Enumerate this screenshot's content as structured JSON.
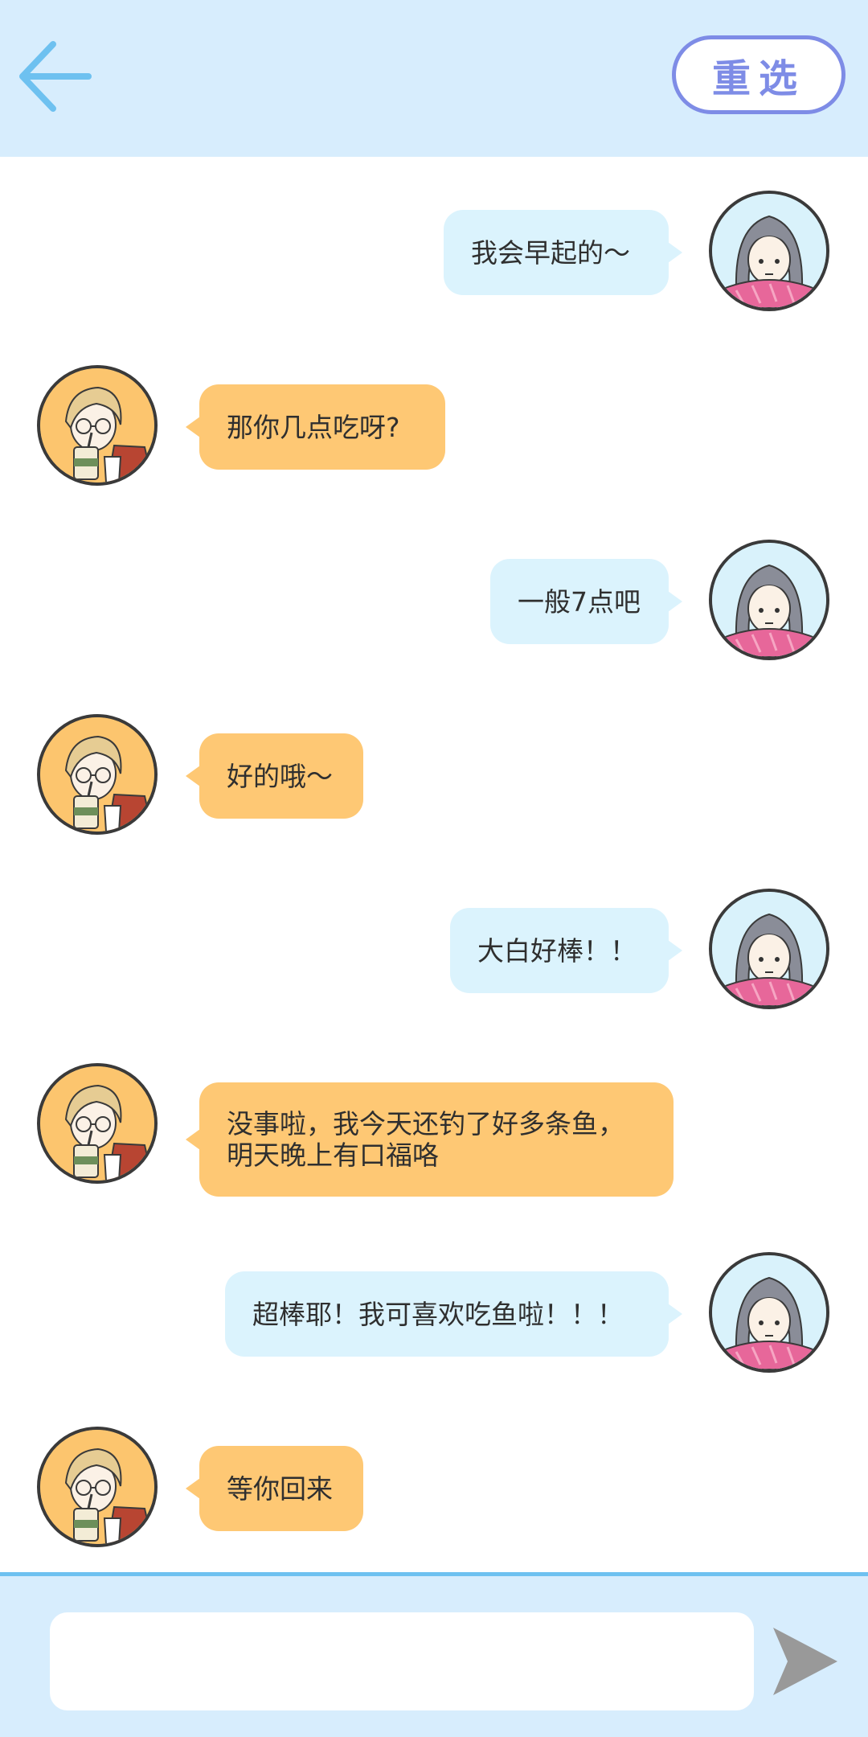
{
  "header": {
    "back_icon": "arrow-left-icon",
    "reselect_label": "重选",
    "accent_color": "#6ec1f0",
    "button_color": "#7e8ce6"
  },
  "messages": [
    {
      "side": "right",
      "speaker": "girl",
      "text": "我会早起的～"
    },
    {
      "side": "left",
      "speaker": "boy",
      "text": "那你几点吃呀?"
    },
    {
      "side": "right",
      "speaker": "girl",
      "text": "一般7点吧"
    },
    {
      "side": "left",
      "speaker": "boy",
      "text": "好的哦～"
    },
    {
      "side": "right",
      "speaker": "girl",
      "text": "大白好棒！！"
    },
    {
      "side": "left",
      "speaker": "boy",
      "text": "没事啦，我今天还钓了好多条鱼，\n明天晚上有口福咯"
    },
    {
      "side": "right",
      "speaker": "girl",
      "text": "超棒耶！我可喜欢吃鱼啦！！！"
    },
    {
      "side": "left",
      "speaker": "boy",
      "text": "等你回来"
    }
  ],
  "composer": {
    "input_value": "",
    "send_icon": "send-icon"
  },
  "colors": {
    "header_bg": "#d7edfd",
    "girl_bubble": "#dbf3fd",
    "boy_bubble": "#fec874"
  }
}
